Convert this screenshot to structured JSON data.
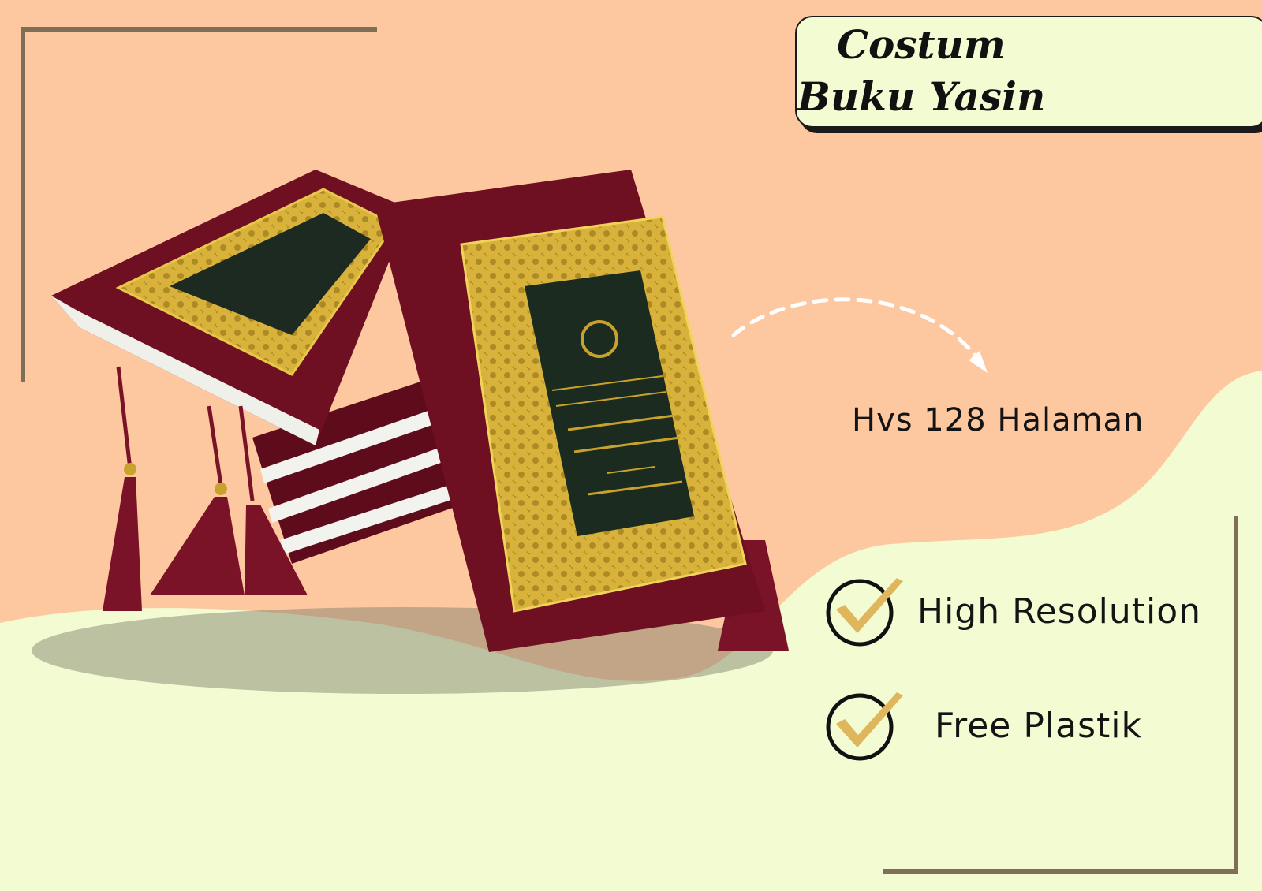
{
  "title": {
    "line1": "Costum",
    "line2": "Buku Yasin"
  },
  "spec": {
    "text": "Hvs 128 Halaman"
  },
  "features": [
    {
      "label": "High Resolution",
      "icon": "check-circle-icon"
    },
    {
      "label": "Free Plastik",
      "icon": "check-circle-icon"
    }
  ],
  "colors": {
    "background_peach": "#fdc8a0",
    "background_cream": "#f3fbd3",
    "frame_line": "#7f6f58",
    "check_gold": "#e0b65c",
    "book_maroon": "#6e0f22",
    "book_gold": "#c9a22c"
  }
}
